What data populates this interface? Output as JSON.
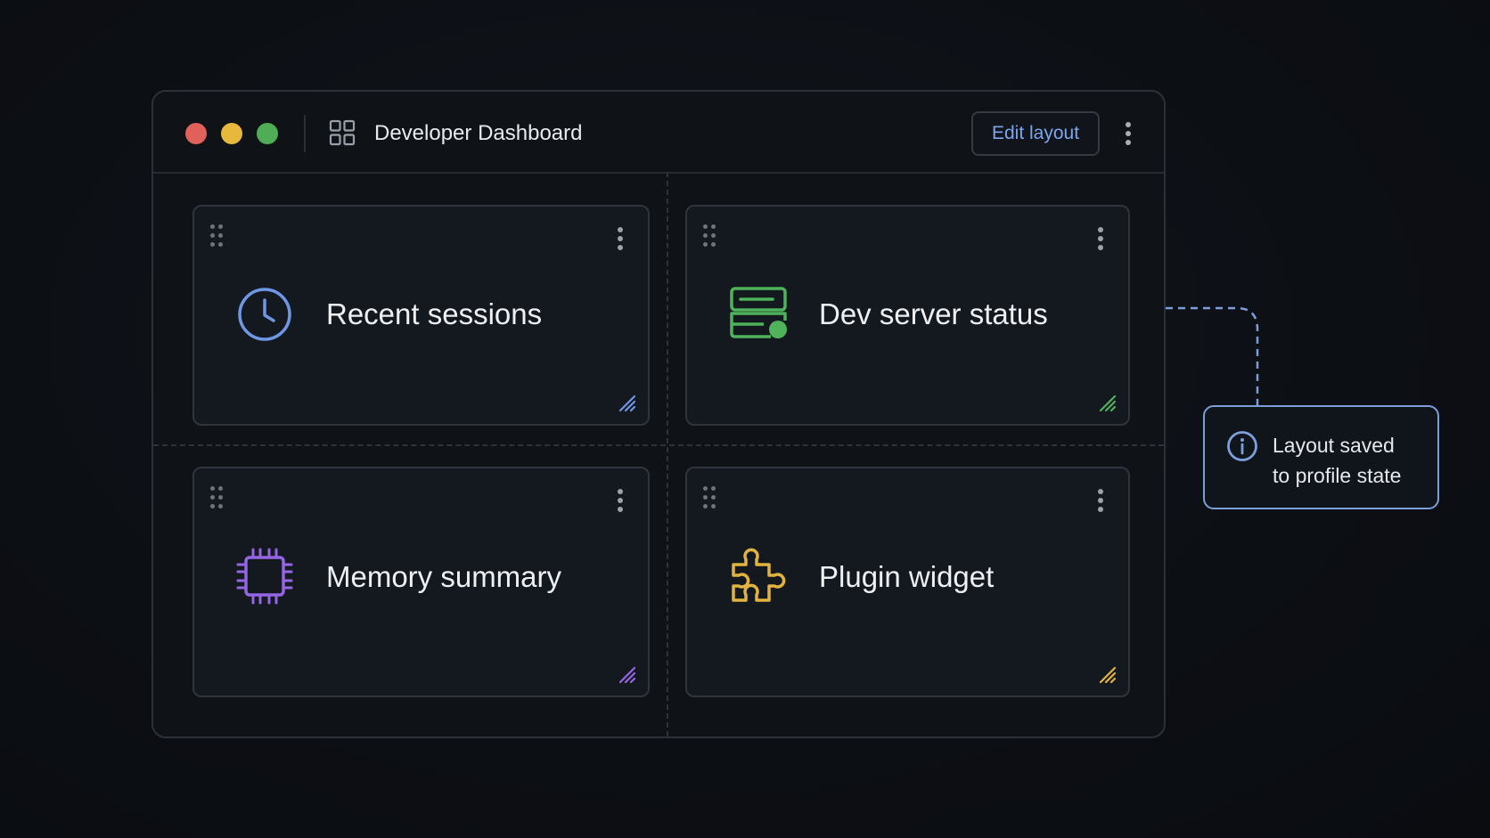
{
  "window": {
    "title": "Developer Dashboard",
    "edit_button_label": "Edit layout",
    "title_icon": "grid-icon",
    "menu_icon": "more-vertical-icon",
    "traffic_lights": {
      "close": "#e0605a",
      "minimize": "#e8b83d",
      "maximize": "#4fae55"
    }
  },
  "widgets": [
    {
      "label": "Recent sessions",
      "icon": "clock-icon",
      "accent": "#6f97e6"
    },
    {
      "label": "Dev server status",
      "icon": "server-status-icon",
      "accent": "#4fb35c"
    },
    {
      "label": "Memory summary",
      "icon": "chip-icon",
      "accent": "#9466e6"
    },
    {
      "label": "Plugin widget",
      "icon": "puzzle-icon",
      "accent": "#e2b33d"
    }
  ],
  "toast": {
    "line1": "Layout saved",
    "line2": "to profile state",
    "icon": "info-icon",
    "accent": "#7b9fd9"
  }
}
